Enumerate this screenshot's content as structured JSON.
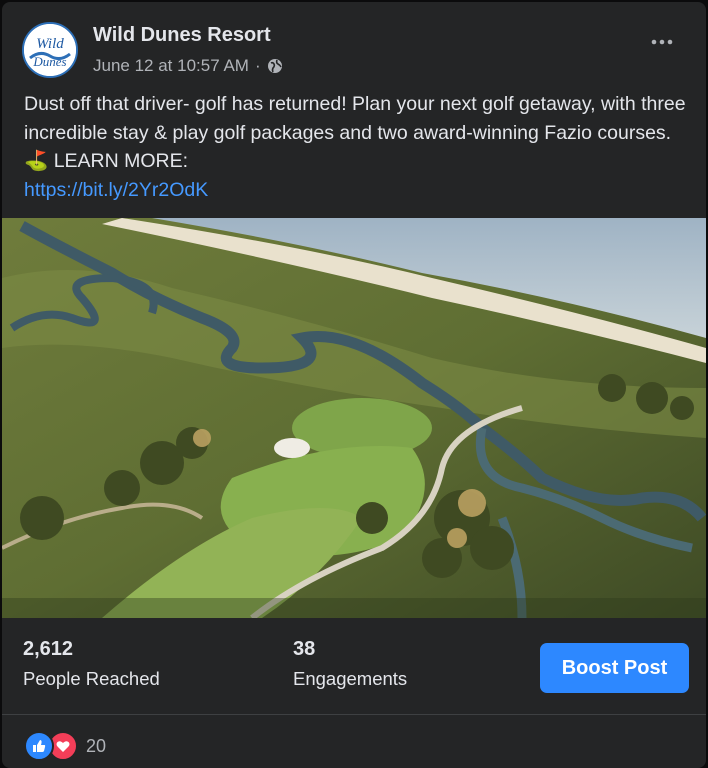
{
  "post": {
    "page_name": "Wild Dunes Resort",
    "timestamp": "June 12 at 10:57 AM",
    "separator": "·",
    "privacy_icon": "globe-icon",
    "avatar_text": "Wild Dunes",
    "more_icon": "more-horizontal-icon",
    "text": "Dust off that driver- golf has returned! Plan your next golf getaway, with three incredible stay & play golf packages and two award-winning Fazio courses. ⛳ LEARN MORE:",
    "link": "https://bit.ly/2Yr2OdK",
    "image_icon": "aerial-golf-course-photo"
  },
  "insights": {
    "reached_value": "2,612",
    "reached_label": "People Reached",
    "engagements_value": "38",
    "engagements_label": "Engagements",
    "boost_label": "Boost Post"
  },
  "reactions": {
    "icons": [
      "like-icon",
      "love-icon"
    ],
    "count": "20"
  },
  "colors": {
    "card_bg": "#242526",
    "link": "#4599ff",
    "boost": "#2d88ff",
    "love": "#f33e58"
  }
}
